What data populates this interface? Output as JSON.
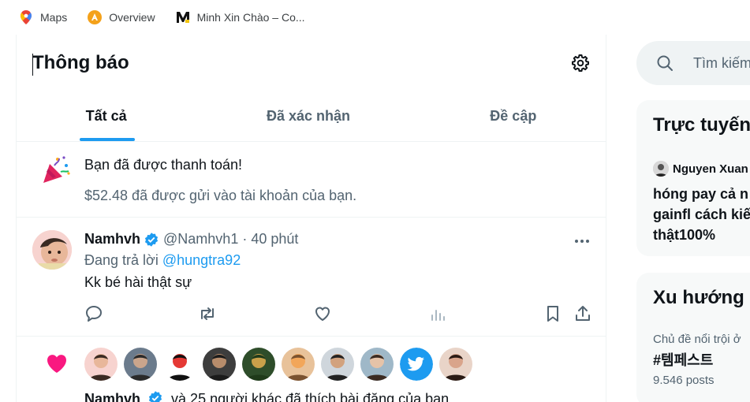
{
  "bookmarks": [
    {
      "label": "Maps",
      "icon": "maps-icon"
    },
    {
      "label": "Overview",
      "icon": "overview-icon"
    },
    {
      "label": "Minh Xin Chào – Co...",
      "icon": "medium-m-icon"
    }
  ],
  "header": {
    "title": "Thông báo",
    "settings_icon": "gear-icon"
  },
  "tabs": [
    {
      "label": "Tất cả",
      "active": true
    },
    {
      "label": "Đã xác nhận",
      "active": false
    },
    {
      "label": "Đề cập",
      "active": false
    }
  ],
  "payment": {
    "icon": "party-popper-icon",
    "title": "Bạn đã được thanh toán!",
    "description": "$52.48 đã được gửi vào tài khoản của bạn."
  },
  "tweet": {
    "name": "Namhvh",
    "handle": "@Namhvh1",
    "separator": "·",
    "time": "40 phút",
    "replying_prefix": "Đang trả lời",
    "replying_to": "@hungtra92",
    "body": "Kk bé hài thật sự"
  },
  "likes": {
    "icon": "heart-icon",
    "avatar_count": 10,
    "name": "Namhvh",
    "text": "và 25 người khác đã thích bài đăng của bạn"
  },
  "search": {
    "placeholder": "Tìm kiếm"
  },
  "live": {
    "title": "Trực tuyến",
    "user": "Nguyen Xuan",
    "lines": [
      "hóng pay cả n",
      "gainfl cách kiế",
      "thật100%"
    ]
  },
  "trends": {
    "title": "Xu hướng",
    "category": "Chủ đề nổi trội ở",
    "tag": "#템페스트",
    "count": "9.546 posts"
  },
  "colors": {
    "accent": "#1d9bf0",
    "text": "#0f1419",
    "muted": "#536471",
    "heart": "#f91880"
  }
}
